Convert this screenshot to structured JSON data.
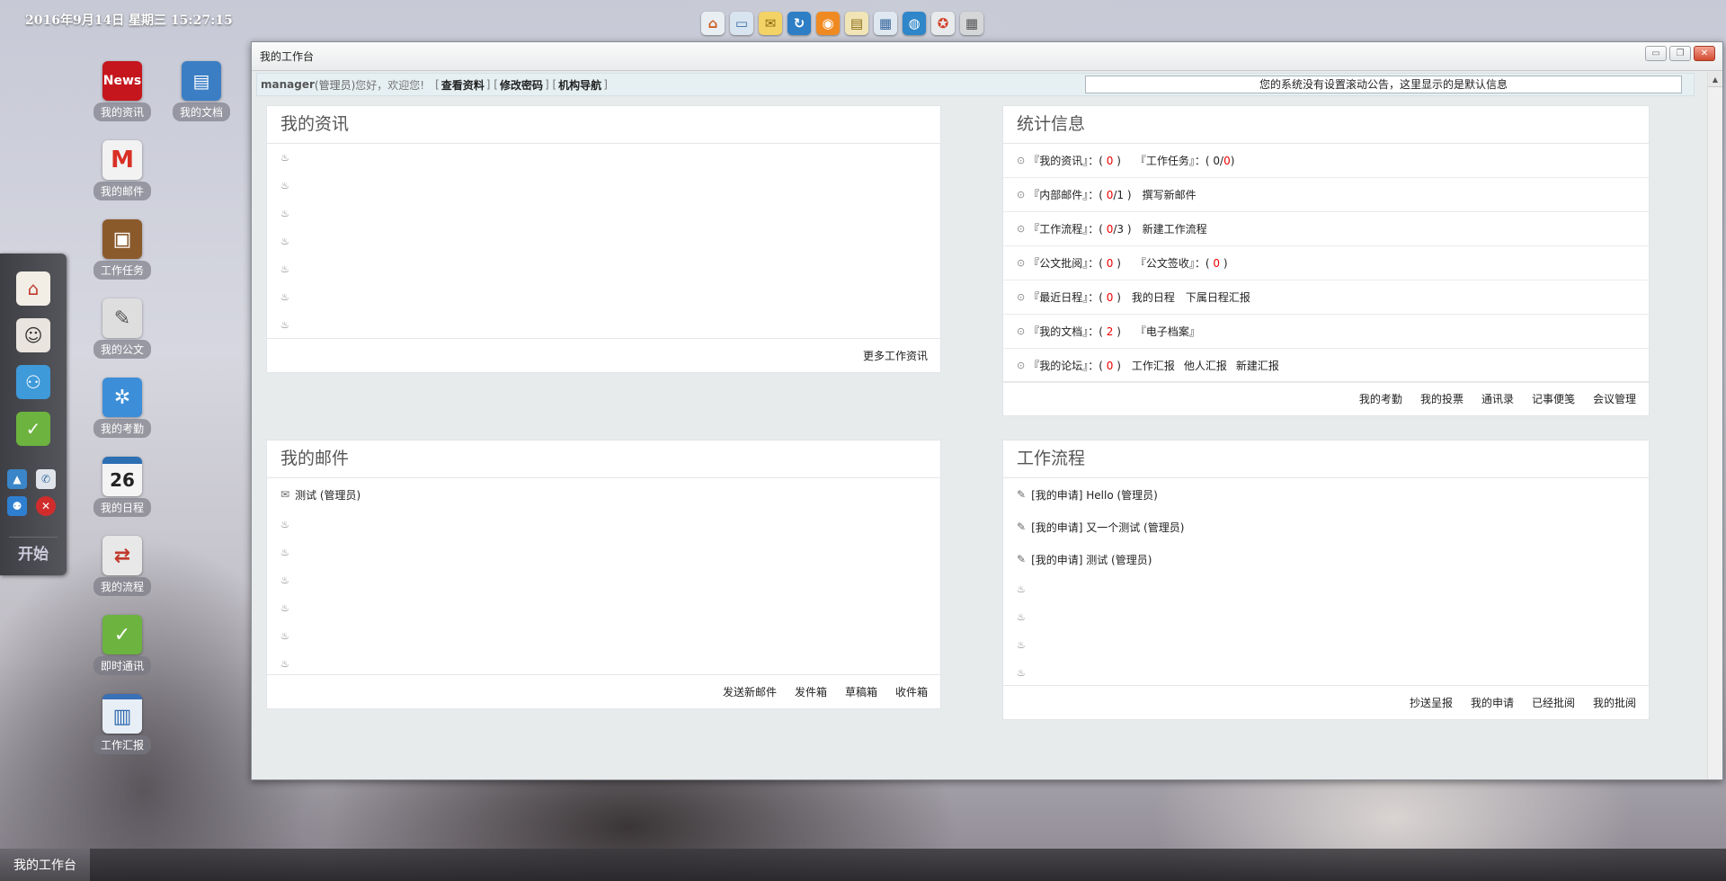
{
  "datetime": "2016年9月14日 星期三 15:27:15",
  "toolbar_icons": [
    "home-icon",
    "window-icon",
    "mail-icon",
    "refresh-icon",
    "rss-icon",
    "document-icon",
    "calendar-icon",
    "globe-icon",
    "help-icon",
    "grid-icon"
  ],
  "desktop_icons": [
    {
      "label": "我的资讯",
      "icon": "news-icon",
      "color": "#c4161c",
      "glyph": "N"
    },
    {
      "label": "我的文档",
      "icon": "document-icon",
      "color": "#3b7ec4",
      "glyph": "▤"
    },
    {
      "label": "我的邮件",
      "icon": "gmail-icon",
      "color": "#e8e8e8",
      "glyph": "M"
    },
    {
      "label": "工作任务",
      "icon": "briefcase-icon",
      "color": "#8b5a2b",
      "glyph": "▣"
    },
    {
      "label": "我的公文",
      "icon": "pen-icon",
      "color": "#dcdcdc",
      "glyph": "✎"
    },
    {
      "label": "我的考勤",
      "icon": "clock-icon",
      "color": "#3c8ed8",
      "glyph": "✲"
    },
    {
      "label": "我的日程",
      "icon": "calendar-icon",
      "color": "#f2f2f2",
      "glyph": "26"
    },
    {
      "label": "我的流程",
      "icon": "flow-icon",
      "color": "#e6e6e6",
      "glyph": "⇄"
    },
    {
      "label": "即时通讯",
      "icon": "chat-icon",
      "color": "#6cb33f",
      "glyph": "✓"
    },
    {
      "label": "工作汇报",
      "icon": "report-icon",
      "color": "#e8eef5",
      "glyph": "▥"
    }
  ],
  "dock": {
    "items": [
      "home-icon",
      "user-avatar-icon",
      "group-icon",
      "chat-icon"
    ],
    "small": [
      "picture-icon",
      "phone-icon",
      "users-icon",
      "close-icon"
    ],
    "start_label": "开始"
  },
  "window": {
    "title": "我的工作台",
    "userbar": {
      "username": "manager",
      "role": "(管理员)",
      "greeting": "您好，欢迎您!",
      "links": [
        "查看资料",
        "修改密码",
        "机构导航"
      ],
      "marquee": "您的系统没有设置滚动公告，这里显示的是默认信息"
    }
  },
  "panels": {
    "news": {
      "title": "我的资讯",
      "empty_rows": 7,
      "footer": [
        "更多工作资讯"
      ]
    },
    "stats": {
      "title": "统计信息",
      "rows": [
        {
          "label": "『我的资讯』：(",
          "num": "0",
          "suffix": ")",
          "extra_label": "『工作任务』：(",
          "extra_a": "0/",
          "extra_num": "0",
          "extra_suffix": ")",
          "actions": []
        },
        {
          "label": "『内部邮件』：(",
          "num": "0",
          "suffix": "/1 )",
          "actions": [
            "撰写新邮件"
          ]
        },
        {
          "label": "『工作流程』：(",
          "num": "0",
          "suffix": "/3 )",
          "actions": [
            "新建工作流程"
          ]
        },
        {
          "label": "『公文批阅』：(",
          "num": "0",
          "suffix": ")",
          "extra_label": "『公文签收』：(",
          "extra_a": "",
          "extra_num": "0",
          "extra_suffix": ")",
          "actions": []
        },
        {
          "label": "『最近日程』：(",
          "num": "0",
          "suffix": ")",
          "actions": [
            "我的日程",
            "下属日程汇报"
          ]
        },
        {
          "label": "『我的文档』：(",
          "num": "2",
          "suffix": ")",
          "extra_label": "『电子档案』",
          "actions": []
        },
        {
          "label": "『我的论坛』：(",
          "num": "0",
          "suffix": ")",
          "actions": [
            "工作汇报",
            "他人汇报",
            "新建汇报"
          ]
        }
      ],
      "footer": [
        "我的考勤",
        "我的投票",
        "通讯录",
        "记事便笺",
        "会议管理"
      ]
    },
    "mail": {
      "title": "我的邮件",
      "items": [
        "测试 (管理员)"
      ],
      "empty_rows": 6,
      "footer": [
        "发送新邮件",
        "发件箱",
        "草稿箱",
        "收件箱"
      ]
    },
    "flow": {
      "title": "工作流程",
      "items": [
        "[我的申请] Hello (管理员)",
        "[我的申请] 又一个测试 (管理员)",
        "[我的申请] 测试 (管理员)"
      ],
      "empty_rows": 4,
      "footer": [
        "抄送呈报",
        "我的申请",
        "已经批阅",
        "我的批阅"
      ]
    }
  },
  "taskbar": {
    "active": "我的工作台"
  }
}
